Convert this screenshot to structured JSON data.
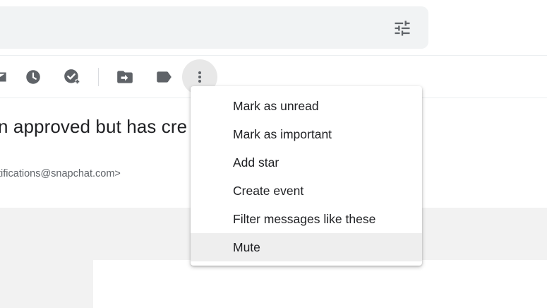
{
  "search": {
    "options_icon": "tune-icon"
  },
  "toolbar": {
    "icons": [
      "mark-unread-icon",
      "snooze-icon",
      "add-to-tasks-icon",
      "move-to-icon",
      "label-icon",
      "more-vert-icon"
    ],
    "icon_color": "#5f6368"
  },
  "message": {
    "subject": "n approved but has cre",
    "sender": "tifications@snapchat.com>"
  },
  "menu": {
    "items": [
      {
        "label": "Mark as unread"
      },
      {
        "label": "Mark as important"
      },
      {
        "label": "Add star"
      },
      {
        "label": "Create event"
      },
      {
        "label": "Filter messages like these"
      },
      {
        "label": "Mute",
        "highlighted": true
      }
    ],
    "highlight_color": "#eeeeee"
  }
}
